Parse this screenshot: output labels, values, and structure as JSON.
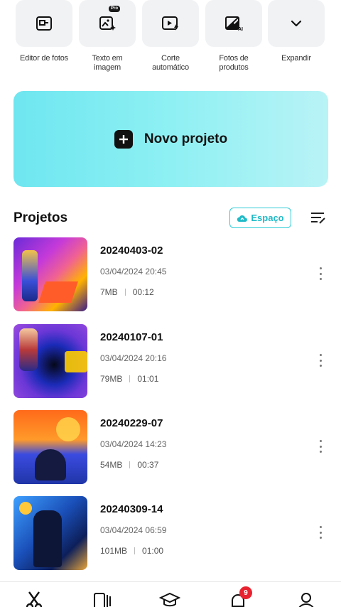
{
  "tools": [
    {
      "label": "Editor de fotos",
      "icon": "photo-editor-icon"
    },
    {
      "label": "Texto em\nimagem",
      "icon": "text-to-image-icon",
      "badge": "Pro"
    },
    {
      "label": "Corte\nautomático",
      "icon": "auto-cut-icon"
    },
    {
      "label": "Fotos de\nprodutos",
      "icon": "product-photo-icon"
    },
    {
      "label": "Expandir",
      "icon": "chevron-down-icon"
    }
  ],
  "new_project": {
    "label": "Novo projeto",
    "icon": "plus-icon"
  },
  "projects": {
    "title": "Projetos",
    "space_label": "Espaço",
    "items": [
      {
        "name": "20240403-02",
        "date": "03/04/2024 20:45",
        "size": "7MB",
        "duration": "00:12"
      },
      {
        "name": "20240107-01",
        "date": "03/04/2024 20:16",
        "size": "79MB",
        "duration": "01:01"
      },
      {
        "name": "20240229-07",
        "date": "03/04/2024 14:23",
        "size": "54MB",
        "duration": "00:37"
      },
      {
        "name": "20240309-14",
        "date": "03/04/2024 06:59",
        "size": "101MB",
        "duration": "01:00"
      }
    ]
  },
  "bottom_nav": {
    "notification_count": "9"
  },
  "colors": {
    "accent": "#1fbac7",
    "banner": "#7fe9f1",
    "badge": "#e8232f"
  }
}
